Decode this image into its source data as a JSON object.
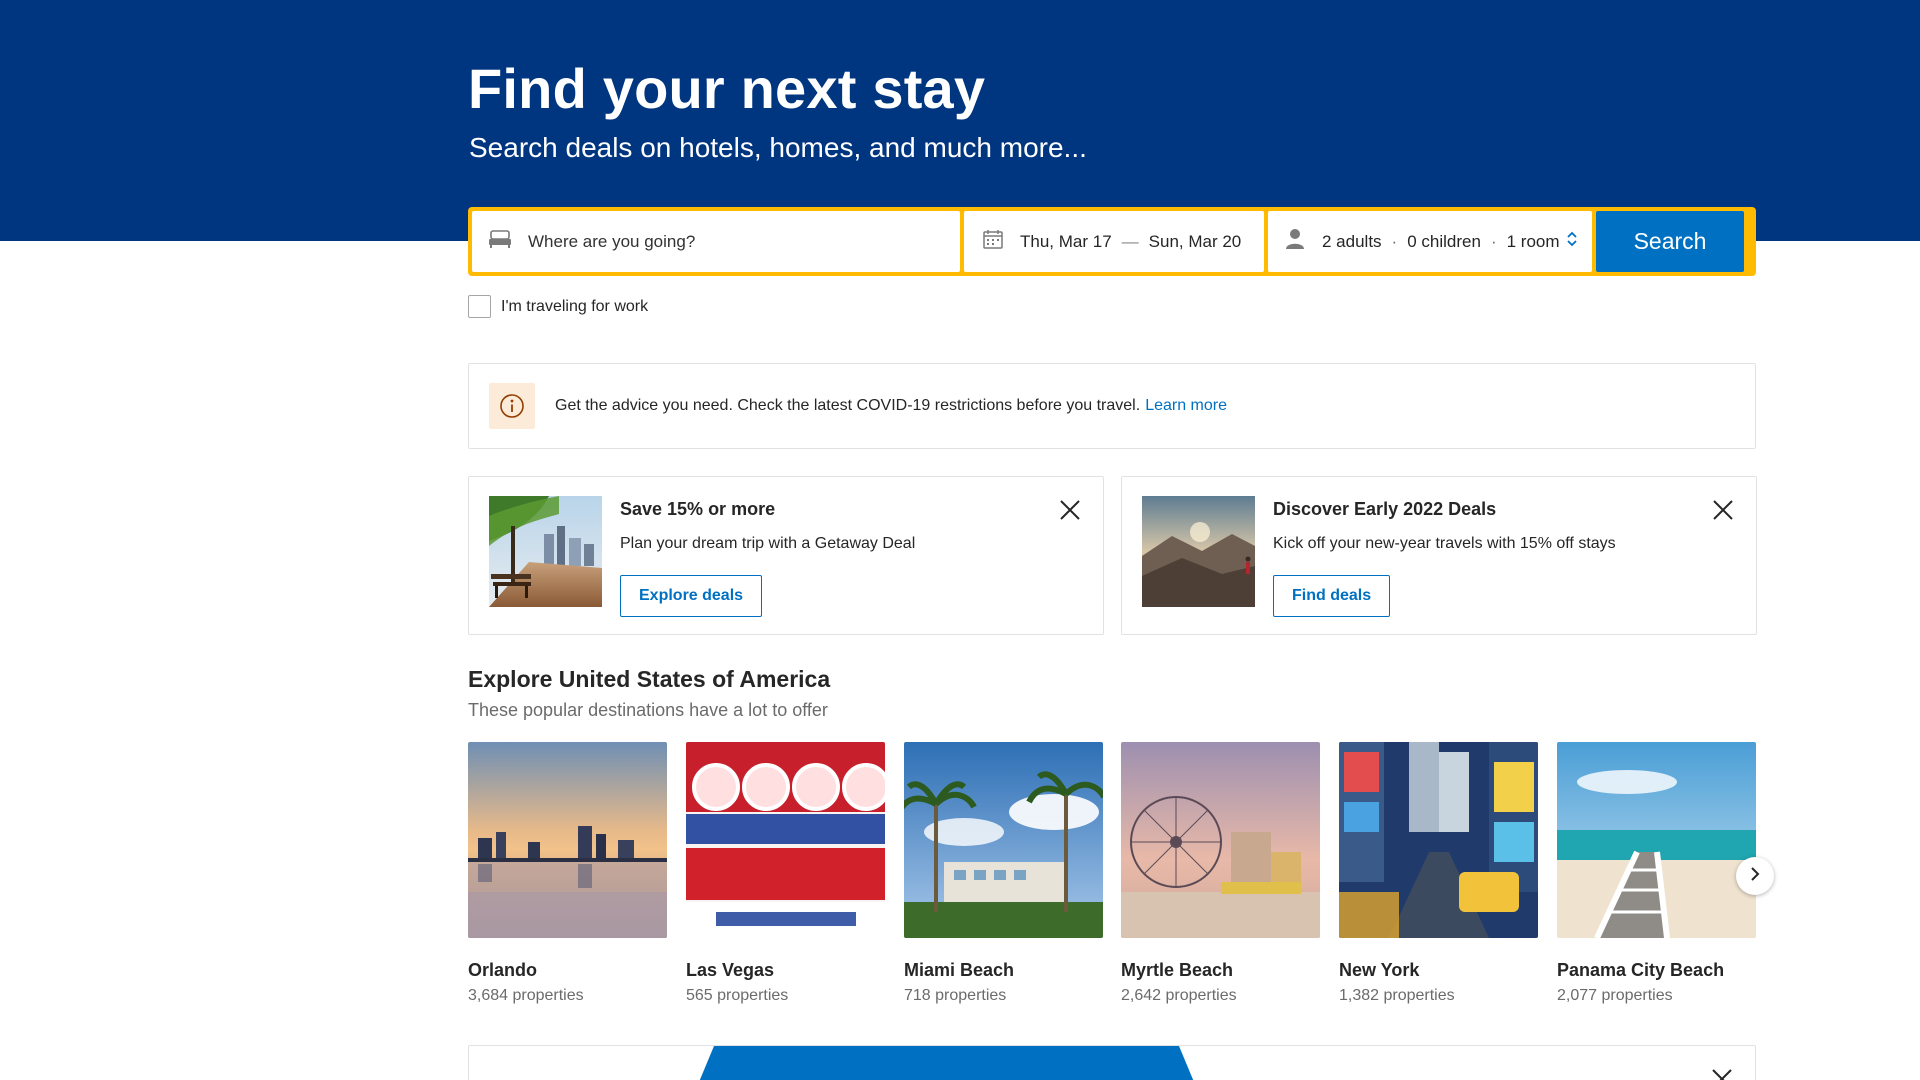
{
  "hero": {
    "title": "Find your next stay",
    "subtitle": "Search deals on hotels, homes, and much more..."
  },
  "search": {
    "destination_placeholder": "Where are you going?",
    "checkin": "Thu, Mar 17",
    "date_separator": "—",
    "checkout": "Sun, Mar 20",
    "adults": "2 adults",
    "children": "0 children",
    "rooms": "1 room",
    "dot": "·",
    "button_label": "Search"
  },
  "work_travel": {
    "label": "I'm traveling for work",
    "checked": false
  },
  "covid": {
    "text": "Get the advice you need. Check the latest COVID-19 restrictions before you travel.",
    "link": "Learn more"
  },
  "promos": [
    {
      "title": "Save 15% or more",
      "text": "Plan your dream trip with a Getaway Deal",
      "button": "Explore deals"
    },
    {
      "title": "Discover Early 2022 Deals",
      "text": "Kick off your new-year travels with 15% off stays",
      "button": "Find deals"
    }
  ],
  "explore": {
    "title": "Explore United States of America",
    "subtitle": "These popular destinations have a lot to offer",
    "destinations": [
      {
        "name": "Orlando",
        "count": "3,684 properties"
      },
      {
        "name": "Las Vegas",
        "count": "565 properties"
      },
      {
        "name": "Miami Beach",
        "count": "718 properties"
      },
      {
        "name": "Myrtle Beach",
        "count": "2,642 properties"
      },
      {
        "name": "New York",
        "count": "1,382 properties"
      },
      {
        "name": "Panama City Beach",
        "count": "2,077 properties"
      }
    ]
  },
  "icons": {
    "destination": "bed-icon",
    "dates": "calendar-icon",
    "guests": "person-icon",
    "guests_toggle": "up-down-chevron-icon",
    "info": "info-icon",
    "close": "close-icon",
    "next": "chevron-right-icon"
  },
  "colors": {
    "brand_blue": "#003580",
    "accent_yellow": "#febb02",
    "button_blue": "#0071c2",
    "info_bg": "#fcebd9"
  }
}
